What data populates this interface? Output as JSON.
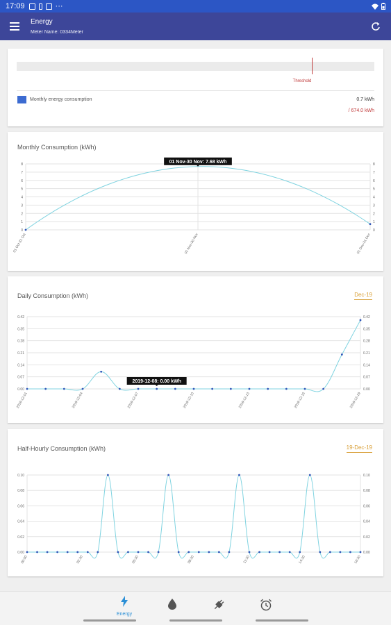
{
  "status_bar": {
    "time": "17:09",
    "dots": "···"
  },
  "app_bar": {
    "title": "Energy",
    "subtitle": "Meter Name: 0334Meter"
  },
  "threshold_card": {
    "threshold_label": "Threshold",
    "legend": "Monthly energy consumption",
    "value": "0.7 kWh",
    "limit": "/ 674.0 kWh",
    "colors": {
      "legend": "#3c6bd1",
      "threshold": "#c03a3a"
    }
  },
  "monthly_card": {
    "title": "Monthly Consumption (kWh)"
  },
  "daily_card": {
    "title": "Daily Consumption (kWh)",
    "date_link": "Dec-19"
  },
  "halfhourly_card": {
    "title": "Half-Hourly Consumption (kWh)",
    "date_link": "19-Dec-19"
  },
  "bottom_nav": {
    "items": [
      {
        "icon": "lightning-icon",
        "label": "Energy",
        "active": true
      },
      {
        "icon": "water-drop-icon",
        "label": ""
      },
      {
        "icon": "plug-icon",
        "label": ""
      },
      {
        "icon": "alarm-clock-icon",
        "label": ""
      }
    ]
  },
  "chart_data": [
    {
      "type": "line",
      "title": "Monthly Consumption (kWh)",
      "x": [
        "01 Oct-31 Oct",
        "01 Nov-30 Nov",
        "01 Dec-31 Dec"
      ],
      "series": [
        {
          "values": [
            0,
            7.68,
            0.7
          ]
        }
      ],
      "ylim": [
        0,
        8
      ],
      "yticks": [
        "0",
        "1",
        "2",
        "3",
        "4",
        "5",
        "6",
        "7",
        "8"
      ],
      "tooltip": "01 Nov-30 Nov: 7.68 kWh",
      "color": "#7fd3e0",
      "grid": true
    },
    {
      "type": "line",
      "title": "Daily Consumption (kWh)",
      "x": [
        "2019-12-01",
        "2019-12-02",
        "2019-12-03",
        "2019-12-04",
        "2019-12-05",
        "2019-12-06",
        "2019-12-07",
        "2019-12-08",
        "2019-12-09",
        "2019-12-10",
        "2019-12-11",
        "2019-12-12",
        "2019-12-13",
        "2019-12-14",
        "2019-12-15",
        "2019-12-16",
        "2019-12-17",
        "2019-12-18",
        "2019-12-19"
      ],
      "xticks": [
        "2019-12-01",
        "2019-12-04",
        "2019-12-07",
        "2019-12-10",
        "2019-12-13",
        "2019-12-16",
        "2019-12-19"
      ],
      "series": [
        {
          "values": [
            0,
            0,
            0,
            0,
            0.1,
            0,
            0,
            0,
            0,
            0,
            0,
            0,
            0,
            0,
            0,
            0,
            0,
            0.2,
            0.4
          ]
        }
      ],
      "ylim": [
        0,
        0.42
      ],
      "yticks": [
        "0.00",
        "0.07",
        "0.14",
        "0.21",
        "0.28",
        "0.35",
        "0.42"
      ],
      "tooltip": "2019-12-08: 0.00 kWh",
      "color": "#7fd3e0",
      "grid": true
    },
    {
      "type": "line",
      "title": "Half-Hourly Consumption (kWh)",
      "xticks": [
        "00:00",
        "02:30",
        "05:30",
        "08:30",
        "11:30",
        "14:30",
        "16:30"
      ],
      "series": [
        {
          "values": [
            0,
            0,
            0,
            0,
            0,
            0,
            0,
            0,
            0.1,
            0,
            0,
            0,
            0,
            0,
            0.1,
            0,
            0,
            0,
            0,
            0,
            0,
            0.1,
            0,
            0,
            0,
            0,
            0,
            0,
            0.1,
            0,
            0,
            0,
            0,
            0
          ]
        }
      ],
      "ylim": [
        0,
        0.1
      ],
      "yticks": [
        "0.00",
        "0.02",
        "0.04",
        "0.06",
        "0.08",
        "0.10"
      ],
      "color": "#7fd3e0",
      "grid": true
    }
  ]
}
